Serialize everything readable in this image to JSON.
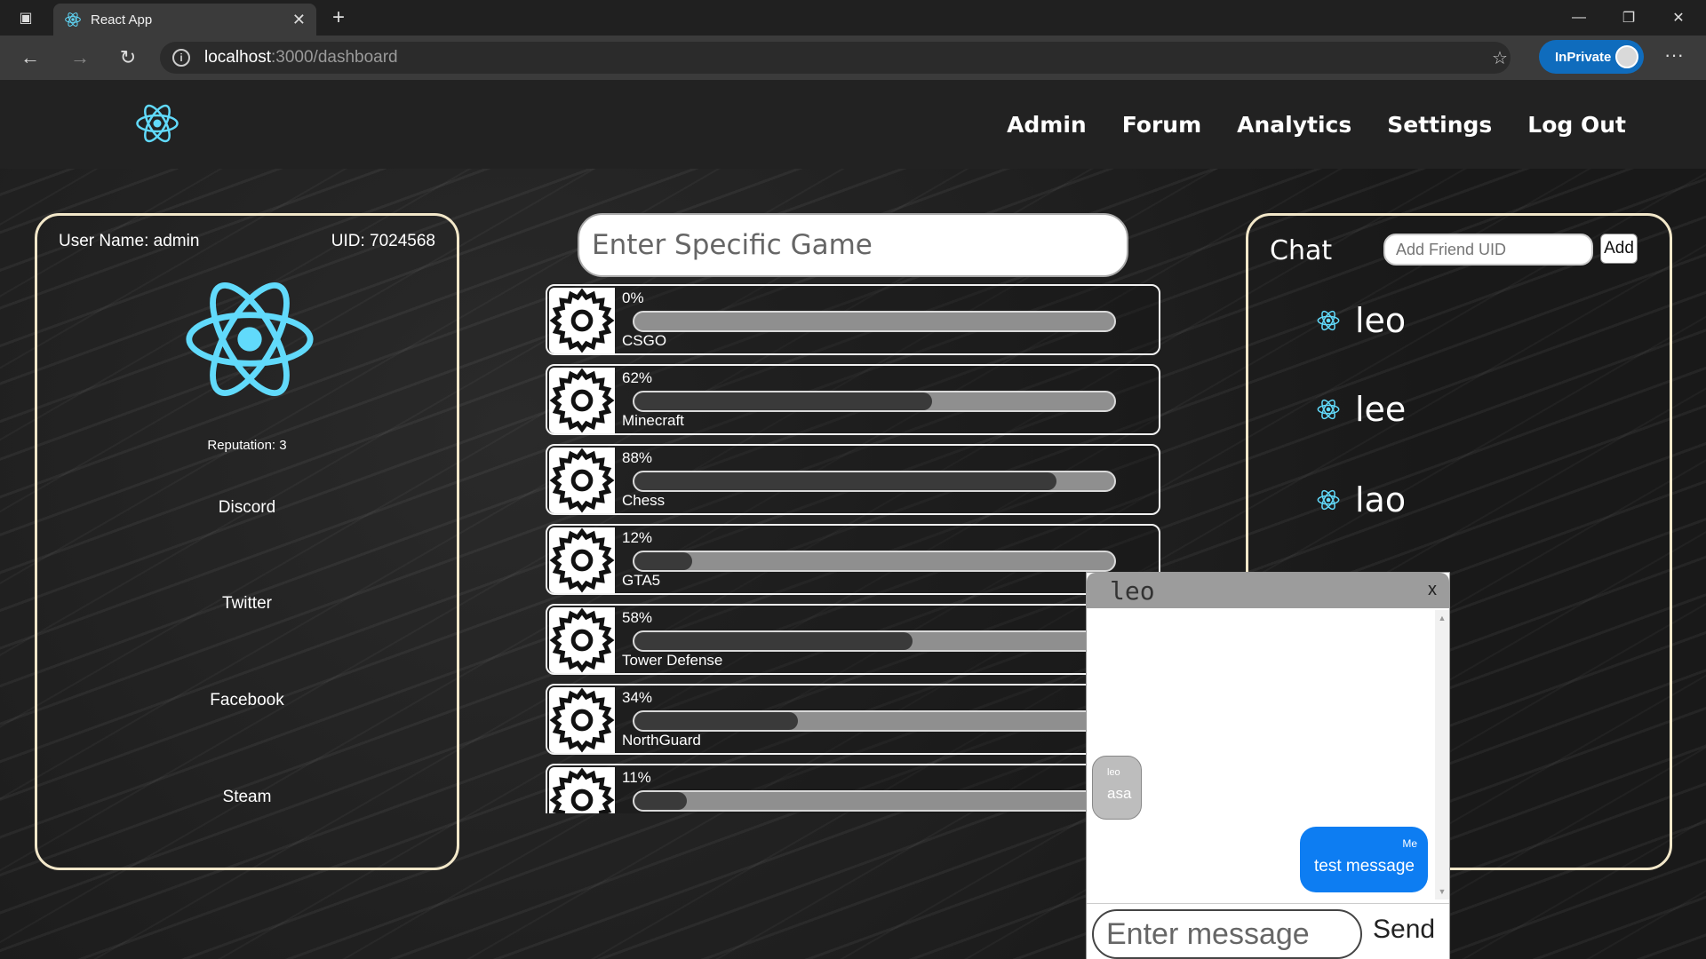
{
  "browser": {
    "tab_title": "React App",
    "url_host": "localhost",
    "url_rest": ":3000/dashboard",
    "inprivate_label": "InPrivate",
    "accent_color": "#0f6cbd"
  },
  "nav": {
    "links": [
      "Admin",
      "Forum",
      "Analytics",
      "Settings",
      "Log Out"
    ]
  },
  "profile": {
    "user_name": "User Name: admin",
    "uid": "UID: 7024568",
    "reputation": "Reputation: 3",
    "socials": [
      "Discord",
      "Twitter",
      "Facebook",
      "Steam"
    ]
  },
  "search": {
    "placeholder": "Enter Specific Game"
  },
  "games": [
    {
      "percent_label": "0%",
      "progress": 0,
      "name": "CSGO"
    },
    {
      "percent_label": "62%",
      "progress": 0.62,
      "name": "Minecraft"
    },
    {
      "percent_label": "88%",
      "progress": 0.88,
      "name": "Chess"
    },
    {
      "percent_label": "12%",
      "progress": 0.12,
      "name": "GTA5"
    },
    {
      "percent_label": "58%",
      "progress": 0.58,
      "name": "Tower Defense"
    },
    {
      "percent_label": "34%",
      "progress": 0.34,
      "name": "NorthGuard"
    },
    {
      "percent_label": "11%",
      "progress": 0.11,
      "name": ""
    }
  ],
  "chat": {
    "title": "Chat",
    "friend_placeholder": "Add Friend UID",
    "add_label": "Add",
    "friends": [
      "leo",
      "lee",
      "lao"
    ]
  },
  "popup": {
    "contact": "leo",
    "close_label": "x",
    "incoming": {
      "sender": "leo",
      "text": "asa"
    },
    "outgoing": {
      "sender": "Me",
      "text": "test message",
      "color": "#0d7df2"
    },
    "input_placeholder": "Enter message",
    "send_label": "Send"
  }
}
